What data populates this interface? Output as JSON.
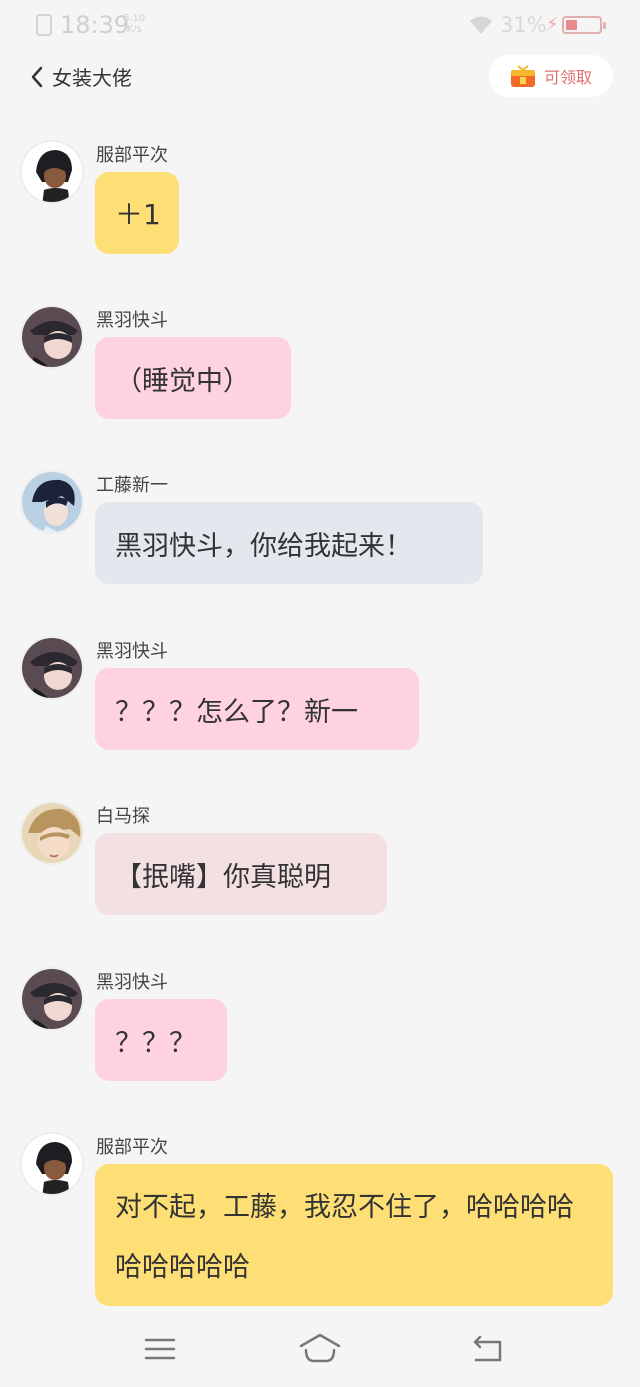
{
  "status_bar": {
    "time": "18:39",
    "speed_value": "6.10",
    "speed_unit": "K/s",
    "battery_percent": "31%"
  },
  "header": {
    "title": "女装大佬",
    "reward_label": "可领取"
  },
  "messages": [
    {
      "sender": "服部平次",
      "text": "＋1",
      "bubble_color": "#fddf76",
      "avatar": "hattori-avatar"
    },
    {
      "sender": "黑羽快斗",
      "text": "（睡觉中）",
      "bubble_color": "#ffd2df",
      "avatar": "kaito-avatar"
    },
    {
      "sender": "工藤新一",
      "text": "黑羽快斗，你给我起来！",
      "bubble_color": "#e3e8ef",
      "avatar": "shinichi-avatar"
    },
    {
      "sender": "黑羽快斗",
      "text": "？？？怎么了？新一",
      "bubble_color": "#ffd2df",
      "avatar": "kaito-avatar"
    },
    {
      "sender": "白马探",
      "text": "【抿嘴】你真聪明",
      "bubble_color": "#f2e0e2",
      "avatar": "hakuba-avatar"
    },
    {
      "sender": "黑羽快斗",
      "text": "？？？",
      "bubble_color": "#ffd2df",
      "avatar": "kaito-avatar"
    },
    {
      "sender": "服部平次",
      "text": "对不起，工藤，我忍不住了，哈哈哈哈哈哈哈哈哈",
      "bubble_color": "#fddf76",
      "avatar": "hattori-avatar"
    }
  ],
  "nav": {
    "menu_icon": "menu-icon",
    "home_icon": "home-icon",
    "back_icon": "back-icon"
  }
}
